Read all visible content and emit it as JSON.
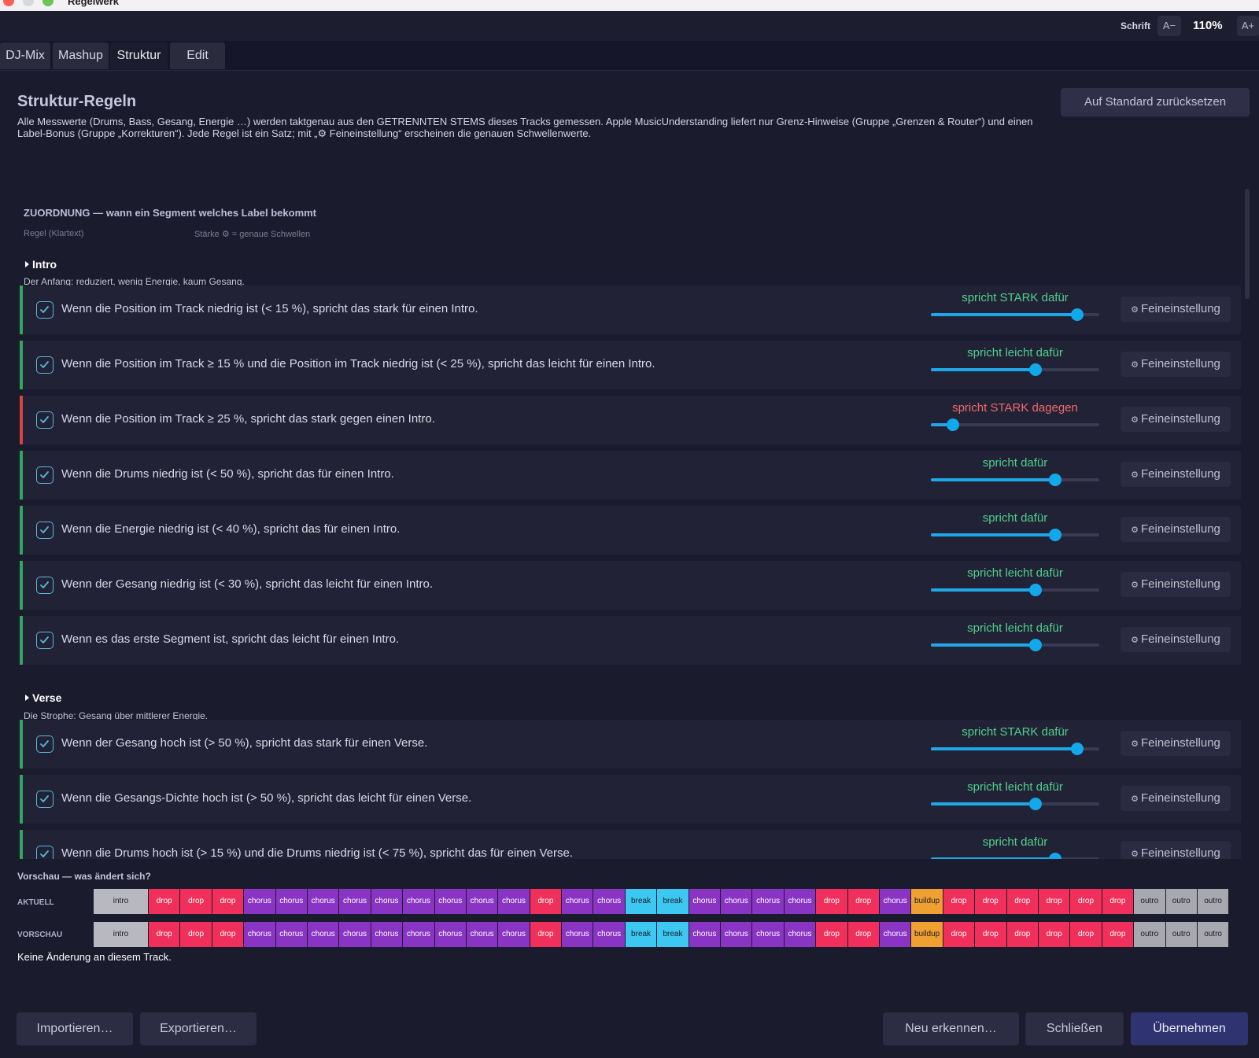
{
  "window": {
    "title": "Regelwerk"
  },
  "zoom": {
    "label": "Schrift",
    "minus": "A−",
    "value": "110%",
    "plus": "A+"
  },
  "tabs": [
    {
      "label": "DJ-Mix",
      "active": false
    },
    {
      "label": "Mashup",
      "active": false
    },
    {
      "label": "Struktur",
      "active": true
    },
    {
      "label": "Edit",
      "active": false
    }
  ],
  "header": {
    "title": "Struktur-Regeln",
    "description": "Alle Messwerte (Drums, Bass, Gesang, Energie …) werden taktgenau aus den GETRENNTEN STEMS dieses Tracks gemessen. Apple MusicUnderstanding liefert nur Grenz-Hinweise (Gruppe „Grenzen & Router“) und einen Label-Bonus (Gruppe „Korrekturen“). Jede Regel ist ein Satz; mit „⚙ Feineinstellung“ erscheinen die genauen Schwellenwerte.",
    "reset_label": "Auf Standard zurücksetzen"
  },
  "section": {
    "title": "ZUORDNUNG — wann ein Segment welches Label bekommt",
    "col_rule": "Regel (Klartext)",
    "col_strength": "Stärke   ⚙ = genaue Schwellen"
  },
  "fein_label": "Feineinstellung",
  "groups": [
    {
      "name": "Intro",
      "description": "Der Anfang: reduziert, wenig Energie, kaum Gesang.",
      "rules": [
        {
          "text": "Wenn die Position im Track niedrig ist (< 15 %), spricht das stark für einen Intro.",
          "strength": "spricht STARK dafür",
          "level": 0.87,
          "polarity": "pos"
        },
        {
          "text": "Wenn die Position im Track ≥ 15 % und die Position im Track niedrig ist (< 25 %), spricht das leicht für einen Intro.",
          "strength": "spricht leicht dafür",
          "level": 0.62,
          "polarity": "pos"
        },
        {
          "text": "Wenn die Position im Track ≥ 25 %, spricht das stark gegen einen Intro.",
          "strength": "spricht STARK dagegen",
          "level": 0.13,
          "polarity": "neg"
        },
        {
          "text": "Wenn die Drums niedrig ist (< 50 %), spricht das für einen Intro.",
          "strength": "spricht dafür",
          "level": 0.74,
          "polarity": "pos"
        },
        {
          "text": "Wenn die Energie niedrig ist (< 40 %), spricht das für einen Intro.",
          "strength": "spricht dafür",
          "level": 0.74,
          "polarity": "pos"
        },
        {
          "text": "Wenn der Gesang niedrig ist (< 30 %), spricht das leicht für einen Intro.",
          "strength": "spricht leicht dafür",
          "level": 0.62,
          "polarity": "pos"
        },
        {
          "text": "Wenn es das erste Segment ist, spricht das leicht für einen Intro.",
          "strength": "spricht leicht dafür",
          "level": 0.62,
          "polarity": "pos"
        }
      ]
    },
    {
      "name": "Verse",
      "description": "Die Strophe: Gesang über mittlerer Energie.",
      "rules": [
        {
          "text": "Wenn der Gesang hoch ist (> 50 %), spricht das stark für einen Verse.",
          "strength": "spricht STARK dafür",
          "level": 0.87,
          "polarity": "pos"
        },
        {
          "text": "Wenn die Gesangs-Dichte hoch ist (> 50 %), spricht das leicht für einen Verse.",
          "strength": "spricht leicht dafür",
          "level": 0.62,
          "polarity": "pos"
        },
        {
          "text": "Wenn die Drums hoch ist (> 15 %) und die Drums niedrig ist (< 75 %), spricht das für einen Verse.",
          "strength": "spricht dafür",
          "level": 0.74,
          "polarity": "pos"
        }
      ]
    }
  ],
  "preview": {
    "title": "Vorschau — was ändert sich?",
    "current_label": "AKTUELL",
    "preview_label": "VORSCHAU",
    "current": [
      "intro",
      "drop",
      "drop",
      "drop",
      "chorus",
      "chorus",
      "chorus",
      "chorus",
      "chorus",
      "chorus",
      "chorus",
      "chorus",
      "chorus",
      "drop",
      "chorus",
      "chorus",
      "break",
      "break",
      "chorus",
      "chorus",
      "chorus",
      "chorus",
      "drop",
      "drop",
      "chorus",
      "buildup",
      "drop",
      "drop",
      "drop",
      "drop",
      "drop",
      "drop",
      "outro",
      "outro",
      "outro"
    ],
    "preview": [
      "intro",
      "drop",
      "drop",
      "drop",
      "chorus",
      "chorus",
      "chorus",
      "chorus",
      "chorus",
      "chorus",
      "chorus",
      "chorus",
      "chorus",
      "drop",
      "chorus",
      "chorus",
      "break",
      "break",
      "chorus",
      "chorus",
      "chorus",
      "chorus",
      "drop",
      "drop",
      "chorus",
      "buildup",
      "drop",
      "drop",
      "drop",
      "drop",
      "drop",
      "drop",
      "outro",
      "outro",
      "outro"
    ],
    "colors": {
      "intro": "#b8b8c0",
      "drop": "#f0305a",
      "chorus": "#8a34c4",
      "break": "#3cc8f0",
      "buildup": "#f0a030",
      "outro": "#a8a8b0"
    },
    "status": "Keine Änderung an diesem Track."
  },
  "footer": {
    "import_label": "Importieren…",
    "export_label": "Exportieren…",
    "detect_label": "Neu erkennen…",
    "close_label": "Schließen",
    "apply_label": "Übernehmen"
  }
}
